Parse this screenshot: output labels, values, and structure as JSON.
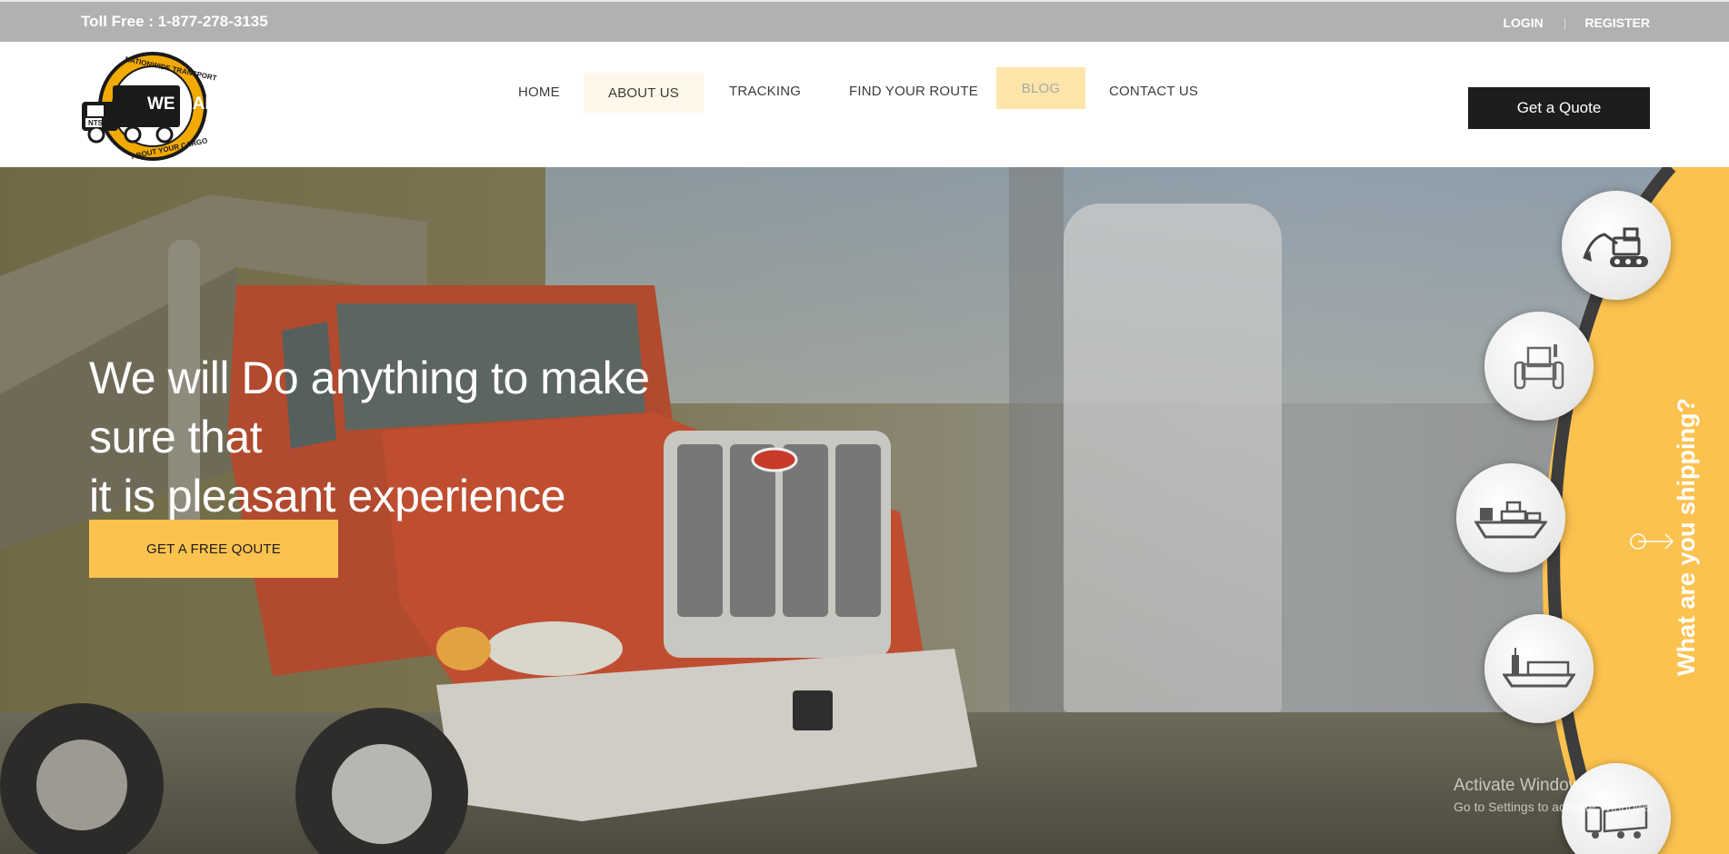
{
  "topbar": {
    "toll_free": "Toll Free : 1-877-278-3135",
    "login": "LOGIN",
    "separator": "|",
    "register": "REGISTER"
  },
  "logo": {
    "top_text": "NATIONWIDE TRANSPORT",
    "main_text": "WE CARE",
    "badge": "NTS",
    "bottom_text": "ABOUT YOUR CARGO"
  },
  "nav": {
    "home": "HOME",
    "about": "ABOUT US",
    "tracking": "TRACKING",
    "route": "FIND YOUR ROUTE",
    "blog": "BLOG",
    "contact": "CONTACT US"
  },
  "header": {
    "quote_button": "Get a Quote"
  },
  "hero": {
    "headline_line1": "We will Do anything to make sure that",
    "headline_line2": "it is pleasant experience",
    "cta": "GET A FREE QOUTE"
  },
  "shipping": {
    "title": "What are you shipping?",
    "items": [
      "excavator-icon",
      "tractor-icon",
      "cargo-ship-icon",
      "freight-ship-icon",
      "car-carrier-icon"
    ]
  },
  "watermark": {
    "line1": "Activate Windows",
    "line2": "Go to Settings to activate Windows."
  },
  "colors": {
    "accent": "#fcc24f",
    "topbar": "#b1b1b1",
    "dark_button": "#1d1d1d"
  }
}
